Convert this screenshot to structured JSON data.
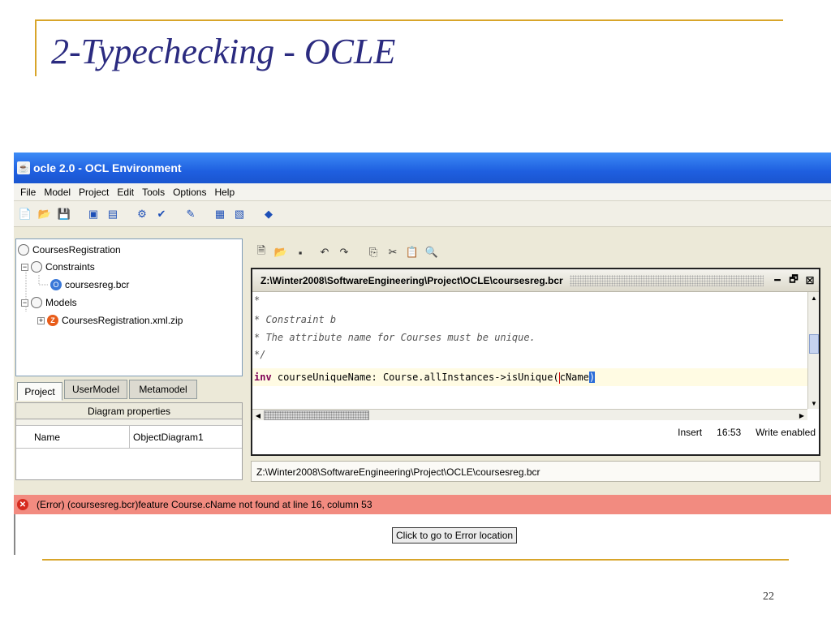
{
  "slide": {
    "title": "2-Typechecking - OCLE",
    "page_number": "22"
  },
  "window": {
    "title": "ocle 2.0 - OCL Environment"
  },
  "menu": [
    "File",
    "Model",
    "Project",
    "Edit",
    "Tools",
    "Options",
    "Help"
  ],
  "tree": {
    "root": "CoursesRegistration",
    "constraints": "Constraints",
    "constraint_file": "coursesreg.bcr",
    "models": "Models",
    "model_file": "CoursesRegistration.xml.zip"
  },
  "tabs": [
    "Project",
    "UserModel",
    "Metamodel"
  ],
  "properties": {
    "header": "Diagram properties",
    "name_label": "Name",
    "name_value": "ObjectDiagram1"
  },
  "editor": {
    "title": "Z:\\Winter2008\\SoftwareEngineering\\Project\\OCLE\\coursesreg.bcr",
    "lines": {
      "l1": "*",
      "l2": "* Constraint b",
      "l3": "* The attribute name for Courses must be unique.",
      "l4": "*/",
      "kw": "inv",
      "code_a": " courseUniqueName: Course.allInstances->isUnique(",
      "code_b": "c",
      "code_c": "Name",
      "code_d": ")"
    },
    "status": {
      "mode": "Insert",
      "position": "16:53",
      "access": "Write enabled"
    }
  },
  "path_bar": "Z:\\Winter2008\\SoftwareEngineering\\Project\\OCLE\\coursesreg.bcr",
  "error": {
    "message": "(Error)  (coursesreg.bcr)feature Course.cName not found at line 16, column 53",
    "button": "Click to go to Error location"
  }
}
